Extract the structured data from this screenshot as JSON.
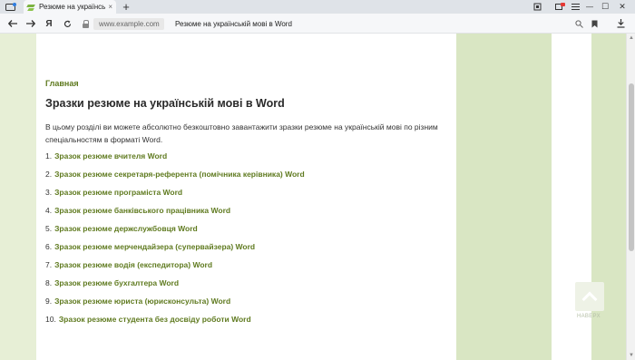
{
  "browser": {
    "tab_title": "Резюме на українській",
    "tab_close": "×",
    "new_tab": "+",
    "address_domain": "www.example.com",
    "address_title": "Резюме на українській мові в Word",
    "window_controls": {
      "minimize": "—",
      "maximize": "☐",
      "close": "✕"
    },
    "accent": "#7cb342"
  },
  "page": {
    "breadcrumb": "Главная",
    "heading": "Зразки резюме на українській мові в Word",
    "intro": "В цьому розділі ви можете абсолютно безкоштовно завантажити зразки резюме на українській мові по різним спеціальностям в форматі Word.",
    "items": [
      {
        "num": "1.",
        "label": "Зразок резюме вчителя Word"
      },
      {
        "num": "2.",
        "label": "Зразок резюме секретаря-референта (помічника керівника) Word"
      },
      {
        "num": "3.",
        "label": "Зразок резюме програміста Word"
      },
      {
        "num": "4.",
        "label": "Зразок резюме банківського працівника Word"
      },
      {
        "num": "5.",
        "label": "Зразок резюме держслужбовця Word"
      },
      {
        "num": "6.",
        "label": "Зразок резюме мерчендайзера (супервайзера) Word"
      },
      {
        "num": "7.",
        "label": "Зразок резюме водія (експедитора) Word"
      },
      {
        "num": "8.",
        "label": "Зразок резюме бухгалтера Word"
      },
      {
        "num": "9.",
        "label": "Зразок резюме юриста (юрисконсульта) Word"
      },
      {
        "num": "10.",
        "label": "Зразок резюме студента без досвіду роботи Word"
      }
    ],
    "to_top_label": "НАВЕРХ",
    "link_color": "#5f7a1f"
  }
}
